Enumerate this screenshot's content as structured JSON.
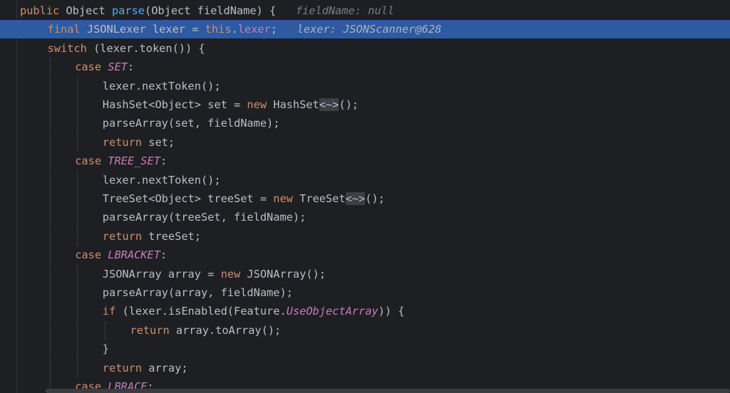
{
  "editor": {
    "lines": [
      {
        "indent": 0,
        "exec": false,
        "tokens": [
          {
            "t": "public ",
            "c": "kw"
          },
          {
            "t": "Object ",
            "c": ""
          },
          {
            "t": "parse",
            "c": "fn"
          },
          {
            "t": "(Object fieldName) {",
            "c": ""
          }
        ],
        "inline": "fieldName: null"
      },
      {
        "indent": 1,
        "exec": true,
        "tokens": [
          {
            "t": "final ",
            "c": "kw"
          },
          {
            "t": "JSONLexer lexer = ",
            "c": ""
          },
          {
            "t": "this",
            "c": "kw"
          },
          {
            "t": ".",
            "c": ""
          },
          {
            "t": "lexer",
            "c": "field"
          },
          {
            "t": ";",
            "c": ""
          }
        ],
        "inline": "lexer: JSONScanner@628"
      },
      {
        "indent": 1,
        "exec": false,
        "tokens": [
          {
            "t": "switch ",
            "c": "kw"
          },
          {
            "t": "(lexer.token()) {",
            "c": ""
          }
        ]
      },
      {
        "indent": 2,
        "exec": false,
        "tokens": [
          {
            "t": "case ",
            "c": "kw"
          },
          {
            "t": "SET",
            "c": "const"
          },
          {
            "t": ":",
            "c": ""
          }
        ]
      },
      {
        "indent": 3,
        "exec": false,
        "tokens": [
          {
            "t": "lexer.nextToken();",
            "c": ""
          }
        ]
      },
      {
        "indent": 3,
        "exec": false,
        "tokens": [
          {
            "t": "HashSet<Object> set = ",
            "c": ""
          },
          {
            "t": "new ",
            "c": "kw"
          },
          {
            "t": "HashSet",
            "c": ""
          },
          {
            "t": "<~>",
            "c": "diamond"
          },
          {
            "t": "();",
            "c": ""
          }
        ]
      },
      {
        "indent": 3,
        "exec": false,
        "tokens": [
          {
            "t": "parseArray(set, fieldName);",
            "c": ""
          }
        ]
      },
      {
        "indent": 3,
        "exec": false,
        "tokens": [
          {
            "t": "return ",
            "c": "kw"
          },
          {
            "t": "set;",
            "c": ""
          }
        ]
      },
      {
        "indent": 2,
        "exec": false,
        "tokens": [
          {
            "t": "case ",
            "c": "kw"
          },
          {
            "t": "TREE_SET",
            "c": "const"
          },
          {
            "t": ":",
            "c": ""
          }
        ]
      },
      {
        "indent": 3,
        "exec": false,
        "tokens": [
          {
            "t": "lexer.nextToken();",
            "c": ""
          }
        ]
      },
      {
        "indent": 3,
        "exec": false,
        "tokens": [
          {
            "t": "TreeSet<Object> treeSet = ",
            "c": ""
          },
          {
            "t": "new ",
            "c": "kw"
          },
          {
            "t": "TreeSet",
            "c": ""
          },
          {
            "t": "<~>",
            "c": "diamond"
          },
          {
            "t": "();",
            "c": ""
          }
        ]
      },
      {
        "indent": 3,
        "exec": false,
        "tokens": [
          {
            "t": "parseArray(treeSet, fieldName);",
            "c": ""
          }
        ]
      },
      {
        "indent": 3,
        "exec": false,
        "tokens": [
          {
            "t": "return ",
            "c": "kw"
          },
          {
            "t": "treeSet;",
            "c": ""
          }
        ]
      },
      {
        "indent": 2,
        "exec": false,
        "tokens": [
          {
            "t": "case ",
            "c": "kw"
          },
          {
            "t": "LBRACKET",
            "c": "const"
          },
          {
            "t": ":",
            "c": ""
          }
        ]
      },
      {
        "indent": 3,
        "exec": false,
        "tokens": [
          {
            "t": "JSONArray array = ",
            "c": ""
          },
          {
            "t": "new ",
            "c": "kw"
          },
          {
            "t": "JSONArray();",
            "c": ""
          }
        ]
      },
      {
        "indent": 3,
        "exec": false,
        "tokens": [
          {
            "t": "parseArray(array, fieldName);",
            "c": ""
          }
        ]
      },
      {
        "indent": 3,
        "exec": false,
        "tokens": [
          {
            "t": "if ",
            "c": "kw"
          },
          {
            "t": "(lexer.isEnabled(Feature.",
            "c": ""
          },
          {
            "t": "UseObjectArray",
            "c": "const"
          },
          {
            "t": ")) {",
            "c": ""
          }
        ]
      },
      {
        "indent": 4,
        "exec": false,
        "tokens": [
          {
            "t": "return ",
            "c": "kw"
          },
          {
            "t": "array.toArray();",
            "c": ""
          }
        ]
      },
      {
        "indent": 3,
        "exec": false,
        "tokens": [
          {
            "t": "}",
            "c": ""
          }
        ]
      },
      {
        "indent": 3,
        "exec": false,
        "tokens": [
          {
            "t": "return ",
            "c": "kw"
          },
          {
            "t": "array;",
            "c": ""
          }
        ]
      },
      {
        "indent": 2,
        "exec": false,
        "tokens": [
          {
            "t": "case ",
            "c": "kw"
          },
          {
            "t": "LBRACE",
            "c": "const"
          },
          {
            "t": ":",
            "c": ""
          }
        ]
      }
    ]
  }
}
